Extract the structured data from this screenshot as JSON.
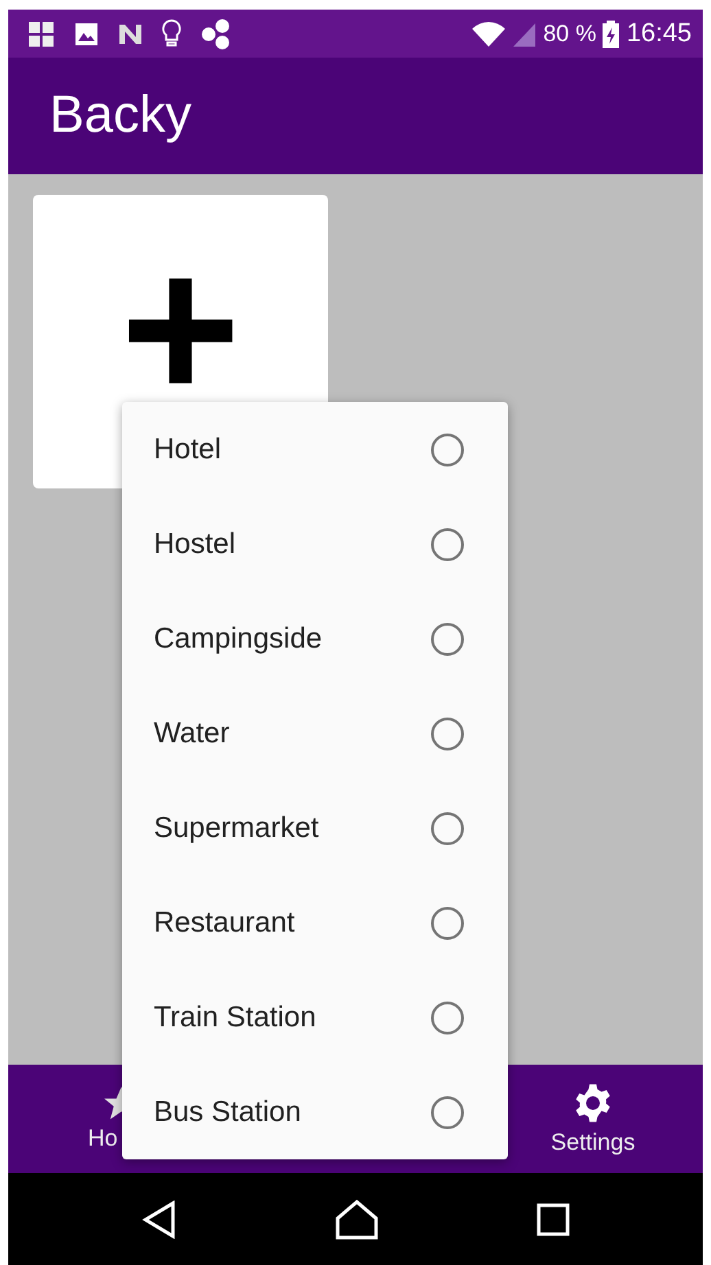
{
  "status_bar": {
    "battery": "80 %",
    "time": "16:45"
  },
  "app_bar": {
    "title": "Backy"
  },
  "add_card": {
    "symbol": "+"
  },
  "menu": {
    "items": [
      {
        "label": "Hotel",
        "selected": false
      },
      {
        "label": "Hostel",
        "selected": false
      },
      {
        "label": "Campingside",
        "selected": false
      },
      {
        "label": "Water",
        "selected": false
      },
      {
        "label": "Supermarket",
        "selected": false
      },
      {
        "label": "Restaurant",
        "selected": false
      },
      {
        "label": "Train Station",
        "selected": false
      },
      {
        "label": "Bus Station",
        "selected": false
      }
    ]
  },
  "bottom_nav": {
    "items": [
      {
        "label": "Ho",
        "kind": "star"
      },
      {
        "kind": "hidden"
      },
      {
        "label": "Settings",
        "kind": "gear"
      }
    ]
  }
}
